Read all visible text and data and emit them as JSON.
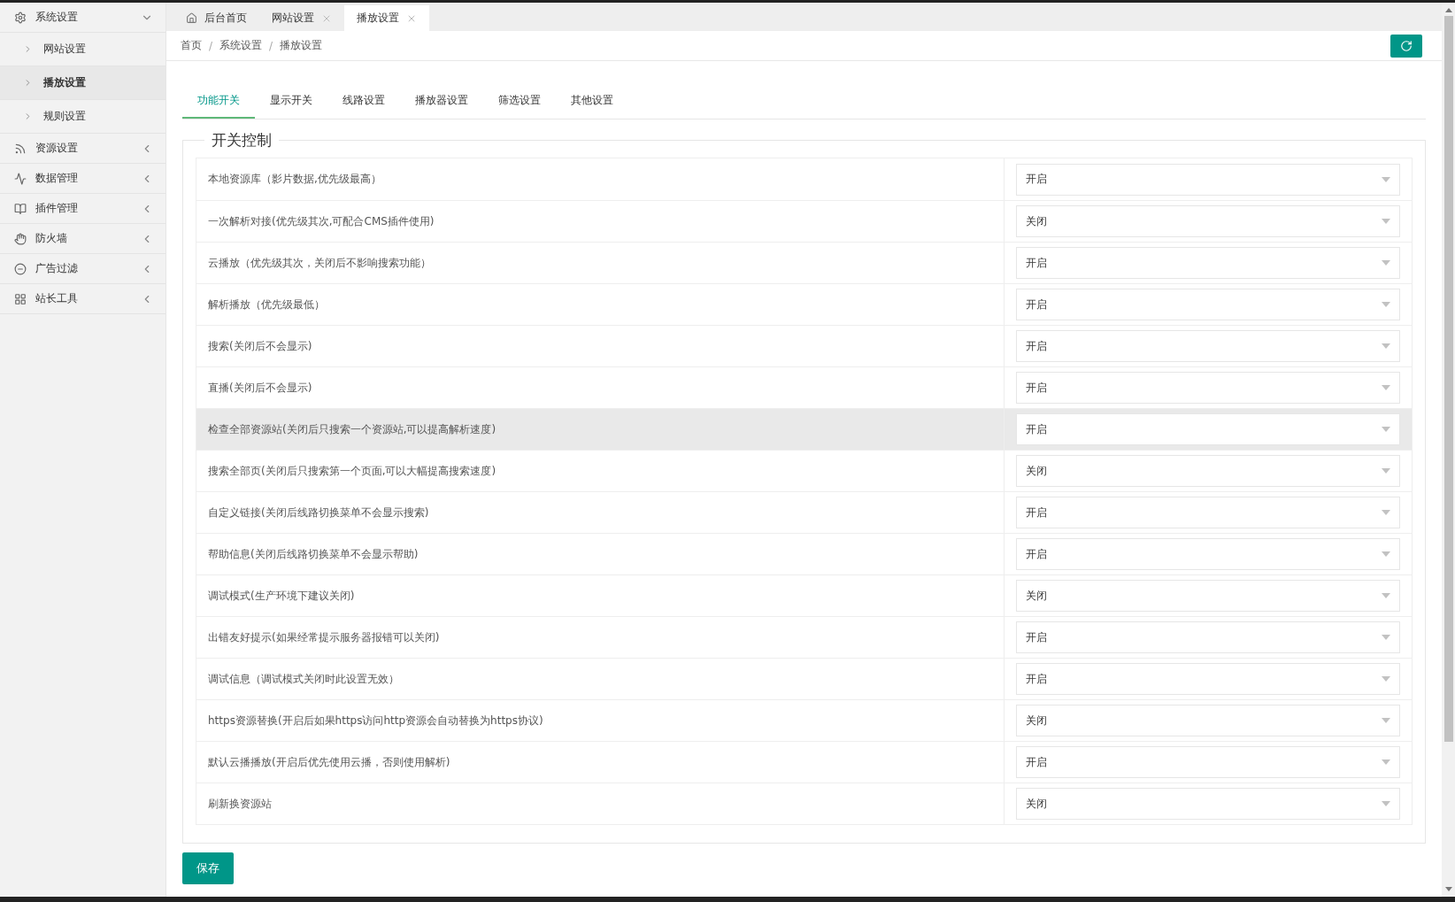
{
  "sidebar": {
    "items": [
      {
        "label": "系统设置",
        "expanded": true,
        "children": [
          {
            "label": "网站设置",
            "selected": false
          },
          {
            "label": "播放设置",
            "selected": true
          },
          {
            "label": "规则设置",
            "selected": false
          }
        ]
      },
      {
        "label": "资源设置",
        "expanded": false
      },
      {
        "label": "数据管理",
        "expanded": false
      },
      {
        "label": "插件管理",
        "expanded": false
      },
      {
        "label": "防火墙",
        "expanded": false
      },
      {
        "label": "广告过滤",
        "expanded": false
      },
      {
        "label": "站长工具",
        "expanded": false
      }
    ]
  },
  "page_tabs": [
    {
      "label": "后台首页",
      "kind": "home",
      "selected": false
    },
    {
      "label": "网站设置",
      "kind": "closable",
      "selected": false
    },
    {
      "label": "播放设置",
      "kind": "closable",
      "selected": true
    }
  ],
  "breadcrumb": [
    {
      "kind": "link",
      "text": "首页"
    },
    {
      "kind": "separator",
      "text": "/"
    },
    {
      "kind": "link",
      "text": "系统设置"
    },
    {
      "kind": "separator",
      "text": "/"
    },
    {
      "kind": "link",
      "text": "播放设置"
    }
  ],
  "settings_tabs": [
    {
      "label": "功能开关",
      "selected": true
    },
    {
      "label": "显示开关",
      "selected": false
    },
    {
      "label": "线路设置",
      "selected": false
    },
    {
      "label": "播放器设置",
      "selected": false
    },
    {
      "label": "筛选设置",
      "selected": false
    },
    {
      "label": "其他设置",
      "selected": false
    }
  ],
  "section_title": "开关控制",
  "rows": [
    {
      "label": "本地资源库（影片数据,优先级最高）",
      "value": "开启",
      "highlighted": false
    },
    {
      "label": "一次解析对接(优先级其次,可配合CMS插件使用)",
      "value": "关闭",
      "highlighted": false
    },
    {
      "label": "云播放（优先级其次，关闭后不影响搜索功能）",
      "value": "开启",
      "highlighted": false
    },
    {
      "label": "解析播放（优先级最低）",
      "value": "开启",
      "highlighted": false
    },
    {
      "label": "搜索(关闭后不会显示)",
      "value": "开启",
      "highlighted": false
    },
    {
      "label": "直播(关闭后不会显示)",
      "value": "开启",
      "highlighted": false
    },
    {
      "label": "检查全部资源站(关闭后只搜索一个资源站,可以提高解析速度)",
      "value": "开启",
      "highlighted": true
    },
    {
      "label": "搜索全部页(关闭后只搜索第一个页面,可以大幅提高搜索速度)",
      "value": "关闭",
      "highlighted": false
    },
    {
      "label": "自定义链接(关闭后线路切换菜单不会显示搜索)",
      "value": "开启",
      "highlighted": false
    },
    {
      "label": "帮助信息(关闭后线路切换菜单不会显示帮助)",
      "value": "开启",
      "highlighted": false
    },
    {
      "label": "调试模式(生产环境下建议关闭)",
      "value": "关闭",
      "highlighted": false
    },
    {
      "label": "出错友好提示(如果经常提示服务器报错可以关闭)",
      "value": "开启",
      "highlighted": false
    },
    {
      "label": "调试信息（调试模式关闭时此设置无效）",
      "value": "开启",
      "highlighted": false
    },
    {
      "label": "https资源替换(开启后如果https访问http资源会自动替换为https协议)",
      "value": "关闭",
      "highlighted": false
    },
    {
      "label": "默认云播播放(开启后优先使用云播，否则使用解析)",
      "value": "开启",
      "highlighted": false
    },
    {
      "label": "刷新换资源站",
      "value": "关闭",
      "highlighted": false
    }
  ],
  "save_button": "保存"
}
